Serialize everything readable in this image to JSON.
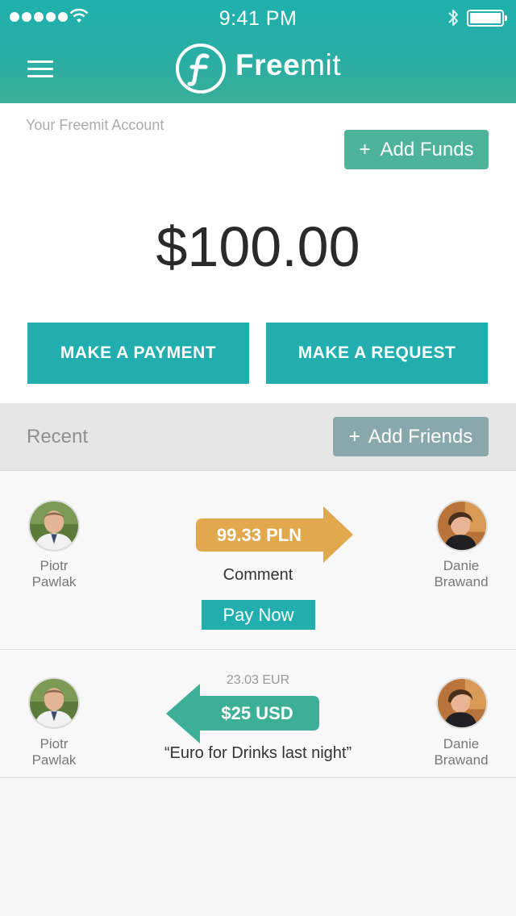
{
  "status_bar": {
    "time": "9:41 PM"
  },
  "header": {
    "logo_bold": "Free",
    "logo_light": "mit"
  },
  "account": {
    "label": "Your Freemit Account",
    "add_funds_icon": "+",
    "add_funds_label": "Add Funds",
    "balance": "$100.00",
    "make_payment_label": "MAKE A PAYMENT",
    "make_request_label": "MAKE A REQUEST"
  },
  "recent": {
    "title": "Recent",
    "add_friends_icon": "+",
    "add_friends_label": "Add Friends"
  },
  "transactions": [
    {
      "from_first": "Piotr",
      "from_last": "Pawlak",
      "to_first": "Danie",
      "to_last": "Brawand",
      "amount": "99.33 PLN",
      "direction": "right",
      "arrow_color": "#e2a84e",
      "comment": "Comment",
      "action_label": "Pay Now"
    },
    {
      "from_first": "Piotr",
      "from_last": "Pawlak",
      "to_first": "Danie",
      "to_last": "Brawand",
      "converted": "23.03 EUR",
      "amount": "$25 USD",
      "direction": "left",
      "arrow_color": "#3daf96",
      "comment": "“Euro for Drinks last night”"
    }
  ],
  "colors": {
    "accent": "#22aeae",
    "add_funds": "#4db39a",
    "add_friends": "#88a8ab",
    "pln_arrow": "#e2a84e",
    "usd_arrow": "#3daf96"
  },
  "icons": [
    "signal-icon",
    "wifi-icon",
    "bluetooth-icon",
    "battery-icon",
    "menu-icon",
    "freemit-logo-icon",
    "avatar"
  ]
}
